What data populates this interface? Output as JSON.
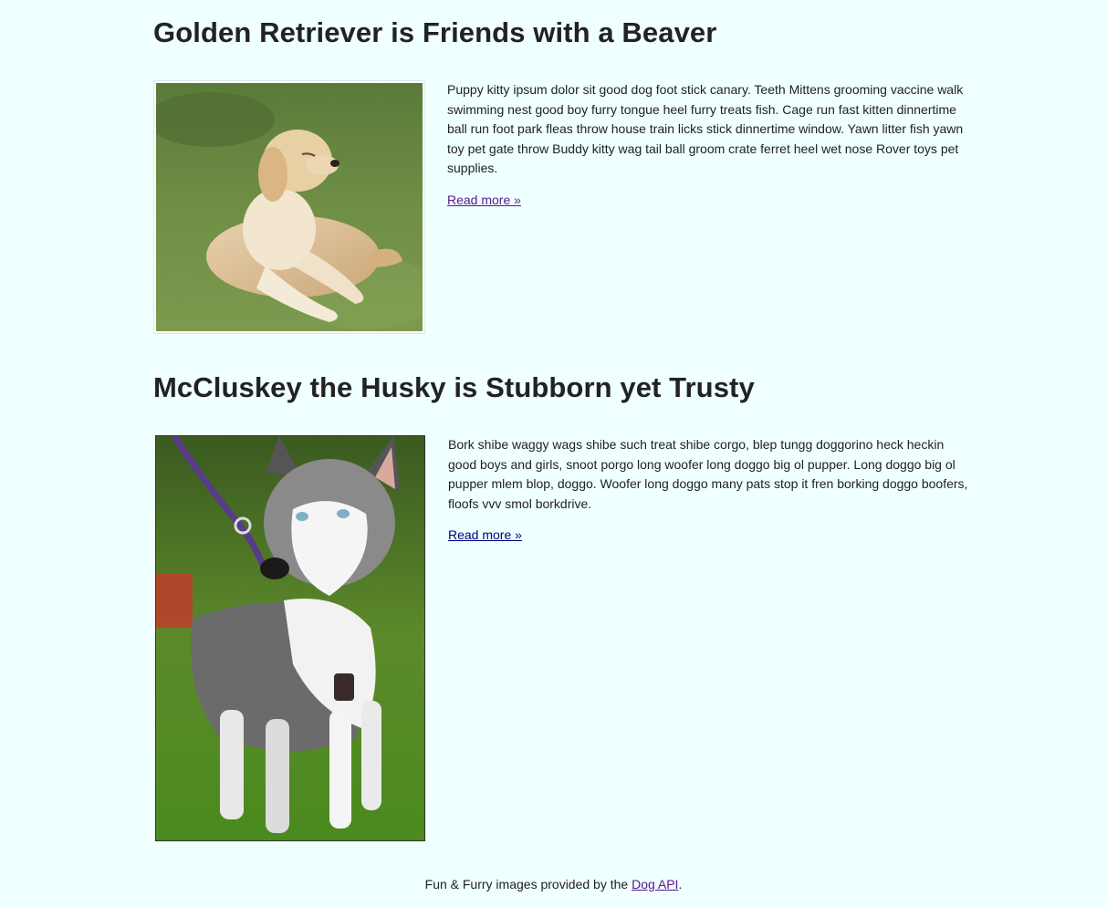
{
  "articles": [
    {
      "title": "Golden Retriever is Friends with a Beaver",
      "image_subject": "golden-retriever-photo",
      "summary": "Puppy kitty ipsum dolor sit good dog foot stick canary. Teeth Mittens grooming vaccine walk swimming nest good boy furry tongue heel furry treats fish. Cage run fast kitten dinnertime ball run foot park fleas throw house train licks stick dinnertime window. Yawn litter fish yawn toy pet gate throw Buddy kitty wag tail ball groom crate ferret heel wet nose Rover toys pet supplies.",
      "read_more": "Read more »"
    },
    {
      "title": "McCluskey the Husky is Stubborn yet Trusty",
      "image_subject": "husky-photo",
      "summary": "Bork shibe waggy wags shibe such treat shibe corgo, blep tungg doggorino heck heckin good boys and girls, snoot porgo long woofer long doggo big ol pupper. Long doggo big ol pupper mlem blop, doggo. Woofer long doggo many pats stop it fren borking doggo boofers, floofs vvv smol borkdrive.",
      "read_more": "Read more »"
    }
  ],
  "footer": {
    "prefix": "Fun & Furry images provided by the ",
    "link": "Dog API",
    "suffix": "."
  },
  "colors": {
    "background": "#f0ffff",
    "text": "#222222",
    "link_visited": "#551a8b",
    "link": "#000080"
  }
}
